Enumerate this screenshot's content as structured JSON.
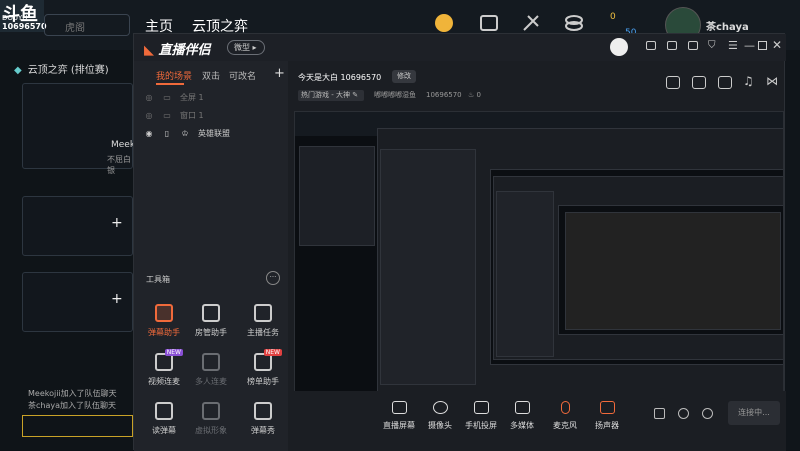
{
  "background_app": {
    "logo_text": "斗鱼",
    "logo_sub": "DOUYU",
    "room_id": "10696570",
    "search_placeholder": "虎阁",
    "nav": [
      "主页",
      "云顶之弈"
    ],
    "header_icons": [
      {
        "name": "avatar-icon",
        "label": "头"
      },
      {
        "name": "task-icon",
        "label": "任务"
      },
      {
        "name": "sword-icon",
        "label": "比赛"
      },
      {
        "name": "coins-icon",
        "label": "鱼丸"
      }
    ],
    "stats": [
      "0",
      "50"
    ],
    "user_name": "茶chaya",
    "game_title": "云顶之弈 (排位赛)",
    "rank_name": "Meek",
    "rank_sub": "不屈白银",
    "chat": [
      "Meekojii加入了队伍聊天",
      "茶chaya加入了队伍聊天"
    ]
  },
  "window": {
    "title": "直播伴侣",
    "version_btn": "微型",
    "sidebar": {
      "tabs": [
        "我的场景",
        "双击",
        "可改名"
      ],
      "scenes": [
        {
          "label": "全屏 1",
          "dim": true
        },
        {
          "label": "窗口 1",
          "dim": true
        },
        {
          "label": "英雄联盟",
          "dim": false
        }
      ],
      "tools_title": "工具箱",
      "tools": [
        {
          "label": "弹幕助手",
          "icon": "danmu-icon",
          "state": "red",
          "badge": ""
        },
        {
          "label": "房管助手",
          "icon": "admin-icon",
          "state": "normal",
          "badge": ""
        },
        {
          "label": "主播任务",
          "icon": "task-icon",
          "state": "normal",
          "badge": ""
        },
        {
          "label": "视频连麦",
          "icon": "video-link-icon",
          "state": "normal",
          "badge": "NEW"
        },
        {
          "label": "多人连麦",
          "icon": "multi-link-icon",
          "state": "dim",
          "badge": ""
        },
        {
          "label": "榜单助手",
          "icon": "rank-icon",
          "state": "normal",
          "badge": "NEW"
        },
        {
          "label": "读弹幕",
          "icon": "read-danmu-icon",
          "state": "normal",
          "badge": ""
        },
        {
          "label": "虚拟形象",
          "icon": "avatar-icon",
          "state": "dim",
          "badge": ""
        },
        {
          "label": "弹幕秀",
          "icon": "danmu-show-icon",
          "state": "normal",
          "badge": ""
        }
      ]
    },
    "room": {
      "title": "今天是大白",
      "id": "10696570",
      "edit_btn": "修改",
      "category": "热门游戏 - 大神",
      "sub_text": "嘟嘟嘟嘟湿鱼",
      "sub_id": "10696570",
      "heat": "0"
    },
    "bottom_bar": [
      {
        "label": "直播屏幕",
        "icon": "screen-icon"
      },
      {
        "label": "摄像头",
        "icon": "camera-icon"
      },
      {
        "label": "手机投屏",
        "icon": "phone-icon"
      },
      {
        "label": "多媒体",
        "icon": "media-icon"
      },
      {
        "label": "麦克风",
        "icon": "mic-icon"
      },
      {
        "label": "扬声器",
        "icon": "speaker-icon"
      }
    ],
    "live_btn": "连接中..."
  },
  "colors": {
    "accent": "#f06a3b",
    "bg": "#1b1e23",
    "sidebar": "#202329"
  }
}
